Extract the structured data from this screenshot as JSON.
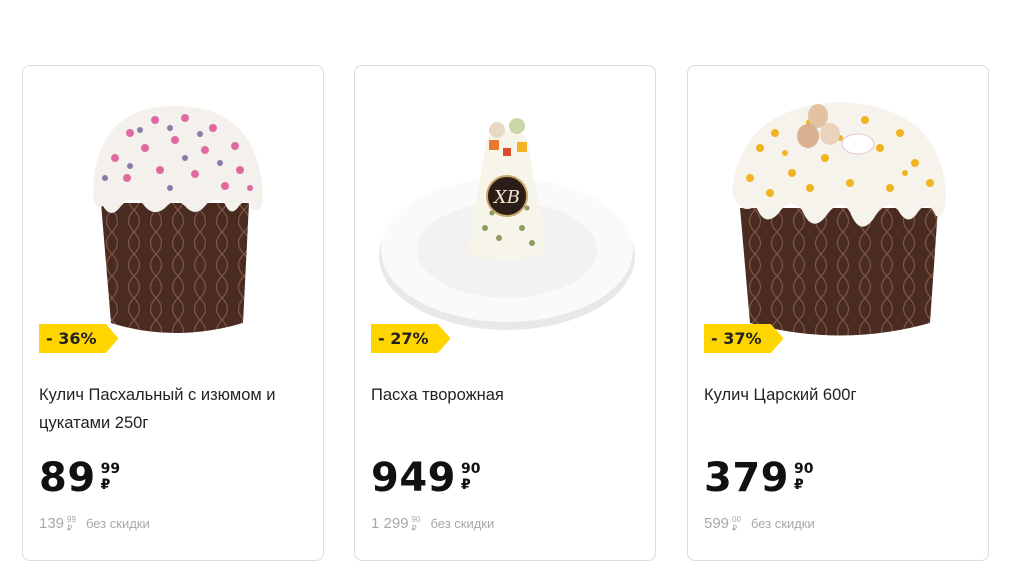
{
  "products": [
    {
      "badge": "- 36%",
      "title": "Кулич Пасхальный с изюмом и цукатами 250г",
      "price_main": "89",
      "price_kop": "99",
      "currency": "₽",
      "old_price_main": "139",
      "old_price_kop": "99",
      "old_currency": "₽",
      "old_note": "без скидки",
      "icon": "easter-cake-pink-sprinkles-image"
    },
    {
      "badge": "- 27%",
      "title": "Пасха творожная",
      "price_main": "949",
      "price_kop": "90",
      "currency": "₽",
      "old_price_main": "1 299",
      "old_price_kop": "90",
      "old_currency": "₽",
      "old_note": "без скидки",
      "icon": "cottage-cheese-paskha-image"
    },
    {
      "badge": "- 37%",
      "title": "Кулич Царский 600г",
      "price_main": "379",
      "price_kop": "90",
      "currency": "₽",
      "old_price_main": "599",
      "old_price_kop": "00",
      "old_currency": "₽",
      "old_note": "без скидки",
      "icon": "easter-cake-gold-sprinkles-image"
    }
  ],
  "colors": {
    "badge": "#ffd500",
    "border": "#dcdcdc",
    "old_price": "#a8a8a8"
  }
}
